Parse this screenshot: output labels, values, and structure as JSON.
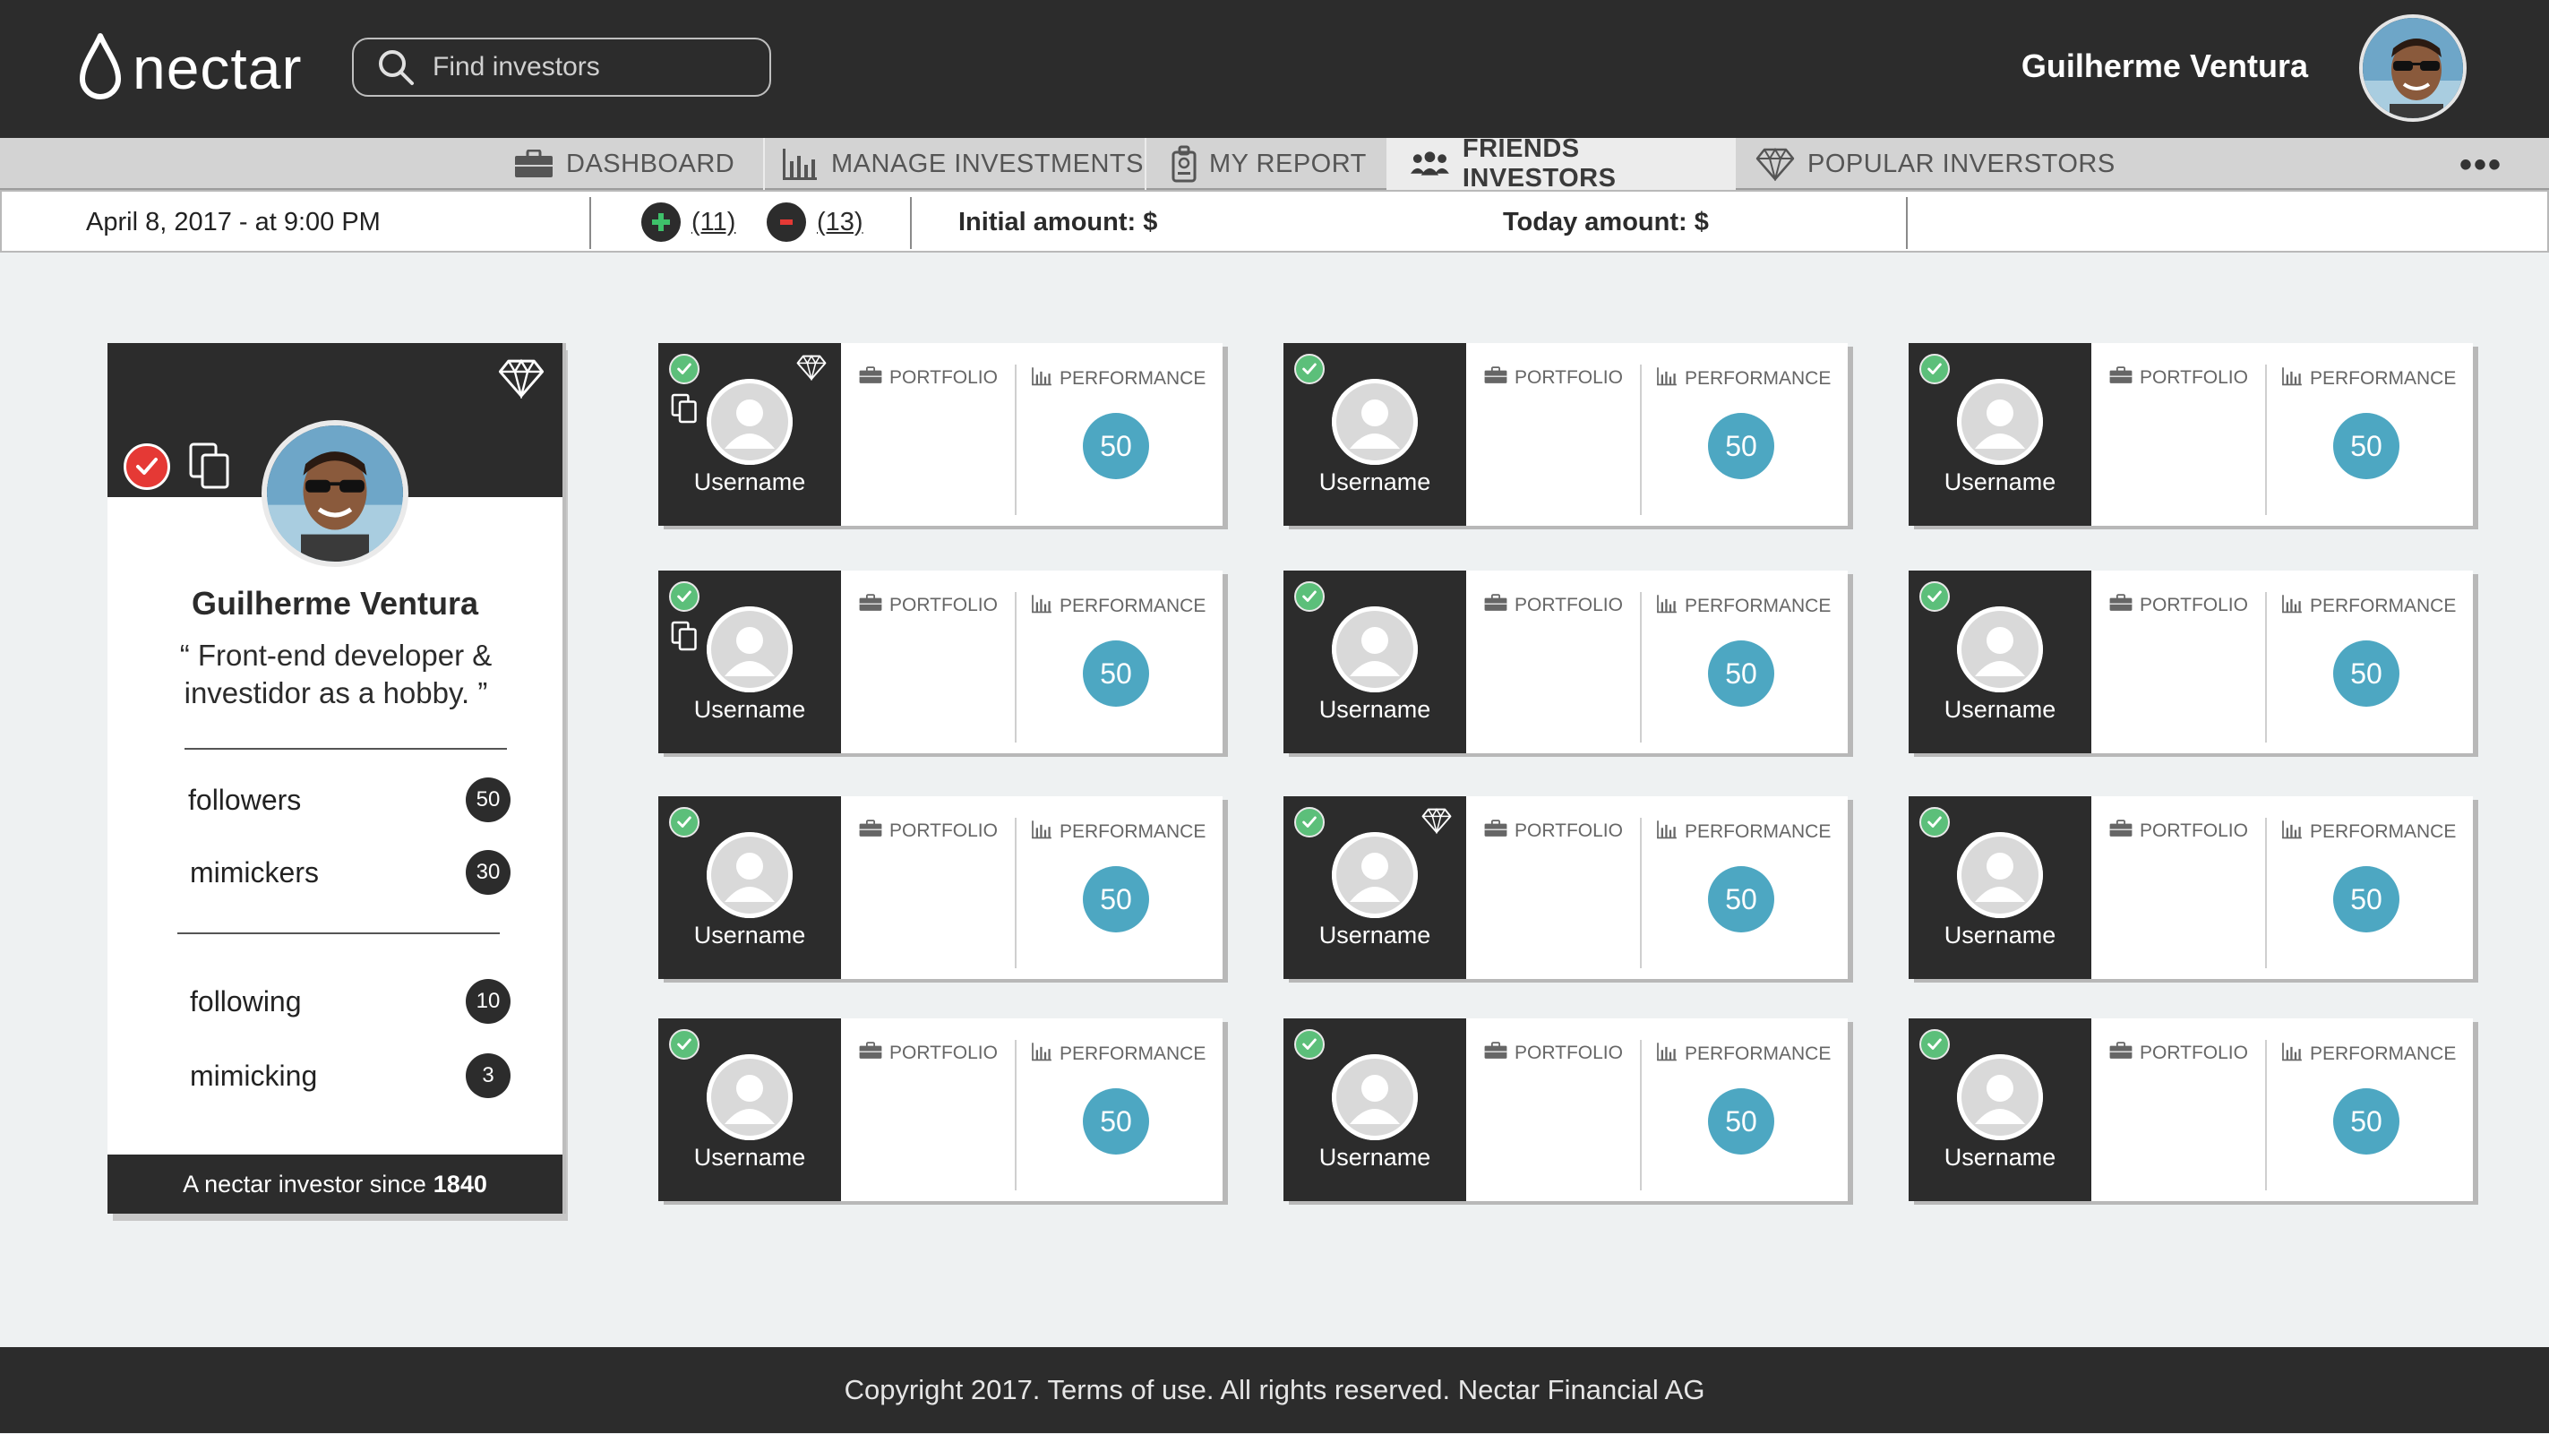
{
  "header": {
    "logo_text": "nectar",
    "search_placeholder": "Find investors",
    "user_name": "Guilherme Ventura"
  },
  "nav": {
    "tabs": [
      {
        "label": "DASHBOARD",
        "icon": "briefcase-icon",
        "active": false
      },
      {
        "label": "MANAGE INVESTMENTS",
        "icon": "bar-chart-icon",
        "active": false
      },
      {
        "label": "MY REPORT",
        "icon": "report-badge-icon",
        "active": false
      },
      {
        "label": "FRIENDS INVESTORS",
        "icon": "users-icon",
        "active": true
      },
      {
        "label": "POPULAR INVERSTORS",
        "icon": "diamond-icon",
        "active": false
      }
    ],
    "more": "•••"
  },
  "infobar": {
    "date": "April 8, 2017 - at 9:00 PM",
    "plus_count": "(11)",
    "minus_count": "(13)",
    "initial_amount": "Initial amount: $",
    "today_amount": "Today amount: $"
  },
  "profile": {
    "name": "Guilherme Ventura",
    "quote_line1": "“ Front-end developer &",
    "quote_line2": "investidor as a hobby. ”",
    "stats": [
      {
        "label": "followers",
        "value": "50"
      },
      {
        "label": "mimickers",
        "value": "30"
      },
      {
        "label": "following",
        "value": "10"
      },
      {
        "label": "mimicking",
        "value": "3"
      }
    ],
    "since_text": "A nectar investor since",
    "since_year": "1840"
  },
  "investors": [
    {
      "username": "Username",
      "portfolio_label": "PORTFOLIO",
      "performance_label": "PERFORMANCE",
      "score": "50",
      "verified": true,
      "diamond": true,
      "copy": true
    },
    {
      "username": "Username",
      "portfolio_label": "PORTFOLIO",
      "performance_label": "PERFORMANCE",
      "score": "50",
      "verified": true,
      "diamond": false,
      "copy": false
    },
    {
      "username": "Username",
      "portfolio_label": "PORTFOLIO",
      "performance_label": "PERFORMANCE",
      "score": "50",
      "verified": true,
      "diamond": false,
      "copy": false
    },
    {
      "username": "Username",
      "portfolio_label": "PORTFOLIO",
      "performance_label": "PERFORMANCE",
      "score": "50",
      "verified": true,
      "diamond": false,
      "copy": true
    },
    {
      "username": "Username",
      "portfolio_label": "PORTFOLIO",
      "performance_label": "PERFORMANCE",
      "score": "50",
      "verified": true,
      "diamond": false,
      "copy": false
    },
    {
      "username": "Username",
      "portfolio_label": "PORTFOLIO",
      "performance_label": "PERFORMANCE",
      "score": "50",
      "verified": true,
      "diamond": false,
      "copy": false
    },
    {
      "username": "Username",
      "portfolio_label": "PORTFOLIO",
      "performance_label": "PERFORMANCE",
      "score": "50",
      "verified": true,
      "diamond": false,
      "copy": false
    },
    {
      "username": "Username",
      "portfolio_label": "PORTFOLIO",
      "performance_label": "PERFORMANCE",
      "score": "50",
      "verified": true,
      "diamond": true,
      "copy": false
    },
    {
      "username": "Username",
      "portfolio_label": "PORTFOLIO",
      "performance_label": "PERFORMANCE",
      "score": "50",
      "verified": true,
      "diamond": false,
      "copy": false
    },
    {
      "username": "Username",
      "portfolio_label": "PORTFOLIO",
      "performance_label": "PERFORMANCE",
      "score": "50",
      "verified": true,
      "diamond": false,
      "copy": false
    },
    {
      "username": "Username",
      "portfolio_label": "PORTFOLIO",
      "performance_label": "PERFORMANCE",
      "score": "50",
      "verified": true,
      "diamond": false,
      "copy": false
    },
    {
      "username": "Username",
      "portfolio_label": "PORTFOLIO",
      "performance_label": "PERFORMANCE",
      "score": "50",
      "verified": true,
      "diamond": false,
      "copy": false
    }
  ],
  "footer": {
    "text": "Copyright 2017. Terms of use. All rights reserved. Nectar Financial AG"
  },
  "colors": {
    "dark": "#2c2c2c",
    "score": "#4da7c2",
    "verified": "#5cbf7a",
    "profile_check": "#e53935",
    "background": "#eef1f2"
  }
}
